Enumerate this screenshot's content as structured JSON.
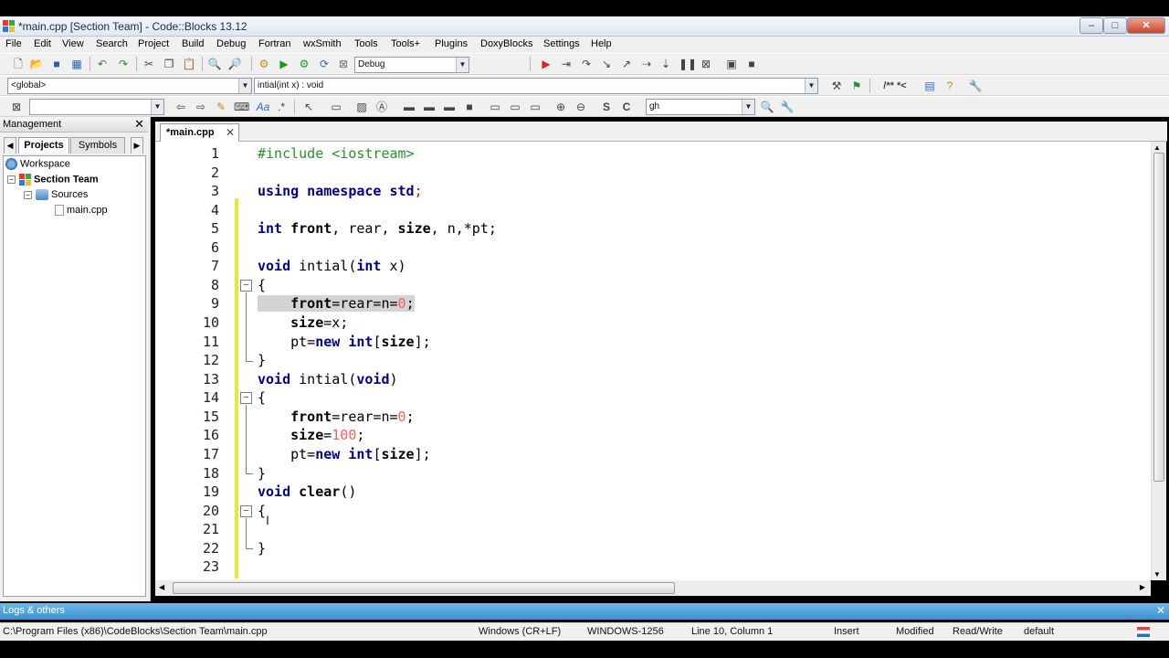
{
  "window": {
    "title": "*main.cpp [Section Team] - Code::Blocks 13.12"
  },
  "menu": [
    "File",
    "Edit",
    "View",
    "Search",
    "Project",
    "Build",
    "Debug",
    "Fortran",
    "wxSmith",
    "Tools",
    "Tools+",
    "Plugins",
    "DoxyBlocks",
    "Settings",
    "Help"
  ],
  "toolbar": {
    "build_target": "Debug",
    "scope": "<global>",
    "symbol": "intial(int x) : void",
    "search_text": "gh"
  },
  "management": {
    "title": "Management",
    "tabs": [
      "Projects",
      "Symbols"
    ],
    "tree": {
      "workspace": "Workspace",
      "project": "Section Team",
      "folder": "Sources",
      "file": "main.cpp"
    }
  },
  "editor": {
    "tab_label": "*main.cpp",
    "line_numbers": [
      "1",
      "2",
      "3",
      "4",
      "5",
      "6",
      "7",
      "8",
      "9",
      "10",
      "11",
      "12",
      "13",
      "14",
      "15",
      "16",
      "17",
      "18",
      "19",
      "20",
      "21",
      "22",
      "23"
    ]
  },
  "logs": {
    "title": "Logs & others"
  },
  "status": {
    "path": "C:\\Program Files (x86)\\CodeBlocks\\Section Team\\main.cpp",
    "eol": "Windows (CR+LF)",
    "encoding": "WINDOWS-1256",
    "position": "Line 10, Column 1",
    "mode": "Insert",
    "modified": "Modified",
    "access": "Read/Write",
    "lang": "default"
  },
  "colors": {
    "keyword": "#00007f",
    "preprocessor": "#2e8b2e",
    "number": "#f06060",
    "logs_bar": "#3d8fd0"
  }
}
